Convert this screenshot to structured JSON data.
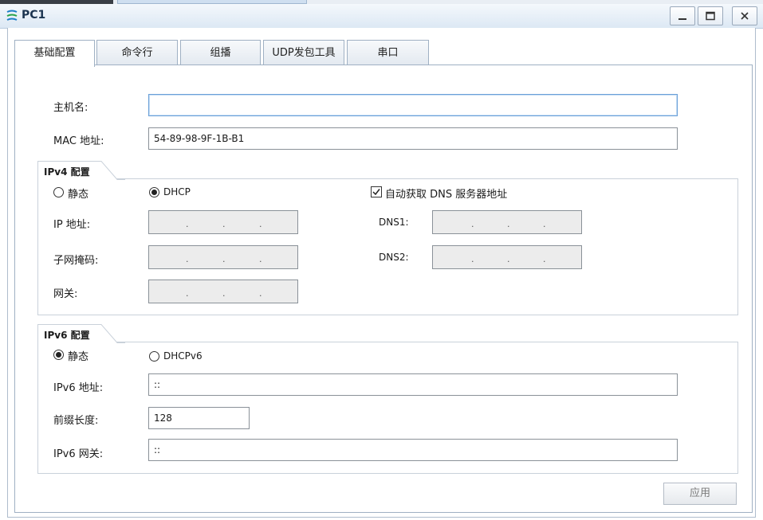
{
  "window": {
    "title": "PC1"
  },
  "tabs": [
    {
      "label": "基础配置",
      "active": true
    },
    {
      "label": "命令行"
    },
    {
      "label": "组播"
    },
    {
      "label": "UDP发包工具"
    },
    {
      "label": "串口"
    }
  ],
  "basic": {
    "hostname_label": "主机名:",
    "hostname_value": "",
    "mac_label": "MAC 地址:",
    "mac_value": "54-89-98-9F-1B-B1"
  },
  "ipv4": {
    "section_title": "IPv4 配置",
    "static_label": "静态",
    "dhcp_label": "DHCP",
    "mode": "DHCP",
    "auto_dns_label": "自动获取 DNS 服务器地址",
    "auto_dns_checked": true,
    "ip_label": "IP 地址:",
    "mask_label": "子网掩码:",
    "gateway_label": "网关:",
    "dns1_label": "DNS1:",
    "dns2_label": "DNS2:",
    "dot": "."
  },
  "ipv6": {
    "section_title": "IPv6 配置",
    "static_label": "静态",
    "dhcp_label": "DHCPv6",
    "mode": "静态",
    "address_label": "IPv6 地址:",
    "address_value": "::",
    "prefix_label": "前缀长度:",
    "prefix_value": "128",
    "gateway_label": "IPv6 网关:",
    "gateway_value": "::"
  },
  "apply_label": "应用",
  "colors": {
    "titlebar": "#dce8f4",
    "focus_border": "#6aa0d8",
    "disabled_field": "#ececec"
  }
}
